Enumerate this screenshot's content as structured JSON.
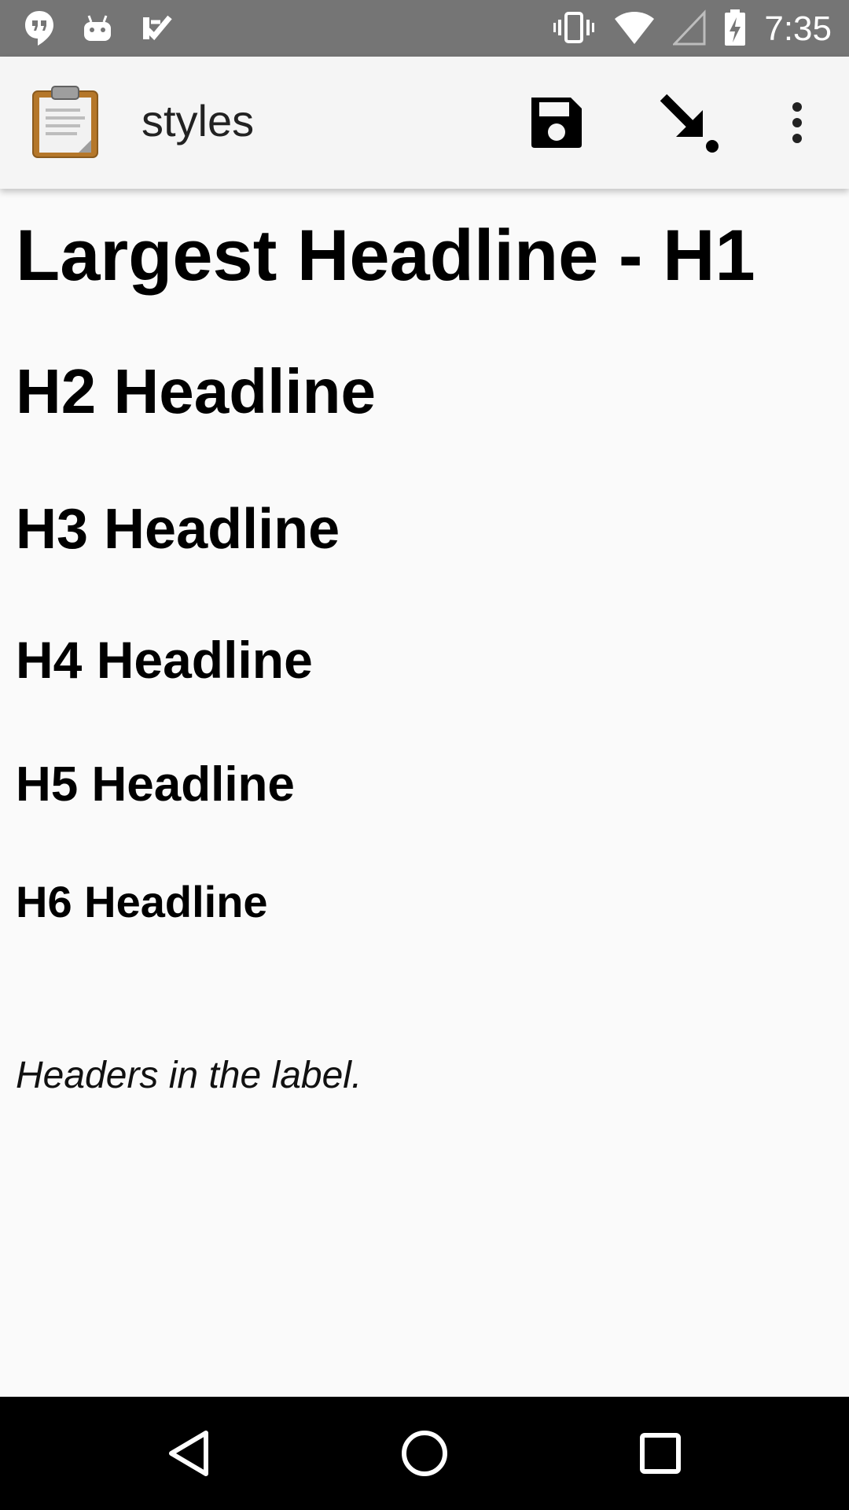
{
  "status_bar": {
    "time": "7:35",
    "icons": [
      "hangouts-icon",
      "android-icon",
      "tasks-icon",
      "vibrate-icon",
      "wifi-icon",
      "cell-signal-icon",
      "battery-charging-icon"
    ]
  },
  "app_bar": {
    "title": "styles",
    "app_icon": "clipboard-icon",
    "actions": [
      "save-icon",
      "import-arrow-icon",
      "more-vert-icon"
    ]
  },
  "content": {
    "h1": "Largest Headline - H1",
    "h2": "H2 Headline",
    "h3": "H3 Headline",
    "h4": "H4 Headline",
    "h5": "H5 Headline",
    "h6": "H6 Headline",
    "label": "Headers in the label."
  },
  "nav_bar": {
    "icons": [
      "back-icon",
      "home-icon",
      "recents-icon"
    ]
  },
  "colors": {
    "status_bar": "#757575",
    "app_bar": "#f5f5f5",
    "background": "#fafafa",
    "nav_bar": "#000000"
  }
}
